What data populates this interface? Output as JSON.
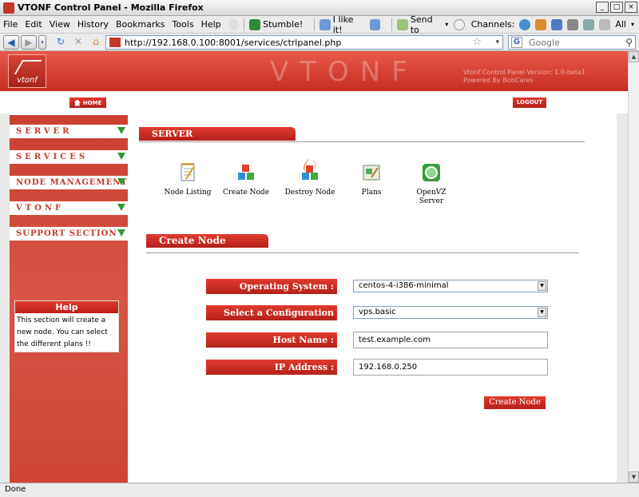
{
  "window": {
    "title": "VTONF Control Panel - Mozilla Firefox"
  },
  "menubar": {
    "items": [
      "File",
      "Edit",
      "View",
      "History",
      "Bookmarks",
      "Tools",
      "Help"
    ],
    "stumble": "Stumble!",
    "like": "I like it!",
    "send_to": "Send to",
    "channels": "Channels:",
    "all": "All"
  },
  "navbar": {
    "url": "http://192.168.0.100:8001/services/ctrlpanel.php",
    "search_placeholder": "Google"
  },
  "header": {
    "brand": "VTONF",
    "logo_text": "vtonf",
    "version_line1": "Vtonf Control Panel Version: 1.0-beta1",
    "version_line2": "Powered By BobCares",
    "home": "HOME",
    "logout": "LOGOUT"
  },
  "sidebar": {
    "items": [
      {
        "label": "SERVER"
      },
      {
        "label": "SERVICES"
      },
      {
        "label": "NODE MANAGEMENT"
      },
      {
        "label": "VTONF"
      },
      {
        "label": "SUPPORT SECTION"
      }
    ],
    "help_title": "Help",
    "help_text": "This section will create a new node. You can select the different plans !!"
  },
  "main": {
    "server_title": "SERVER",
    "tools": [
      {
        "label": "Node Listing",
        "icon": "notepad-icon"
      },
      {
        "label": "Create Node",
        "icon": "cubes-icon"
      },
      {
        "label": "Destroy Node",
        "icon": "fire-cubes-icon"
      },
      {
        "label": "Plans",
        "icon": "plans-icon"
      },
      {
        "label": "OpenVZ Server",
        "icon": "openvz-icon"
      }
    ],
    "create_title": "Create Node",
    "form": {
      "os_label": "Operating System :",
      "os_value": "centos-4-i386-minimal",
      "config_label": "Select a Configuration file:",
      "config_value": "vps.basic",
      "host_label": "Host Name :",
      "host_value": "test.example.com",
      "ip_label": "IP Address :",
      "ip_value": "192.168.0.250",
      "submit": "Create Node"
    }
  },
  "status": {
    "text": "Done"
  },
  "colors": {
    "accent": "#c72d22",
    "green": "#2e9a2e"
  }
}
